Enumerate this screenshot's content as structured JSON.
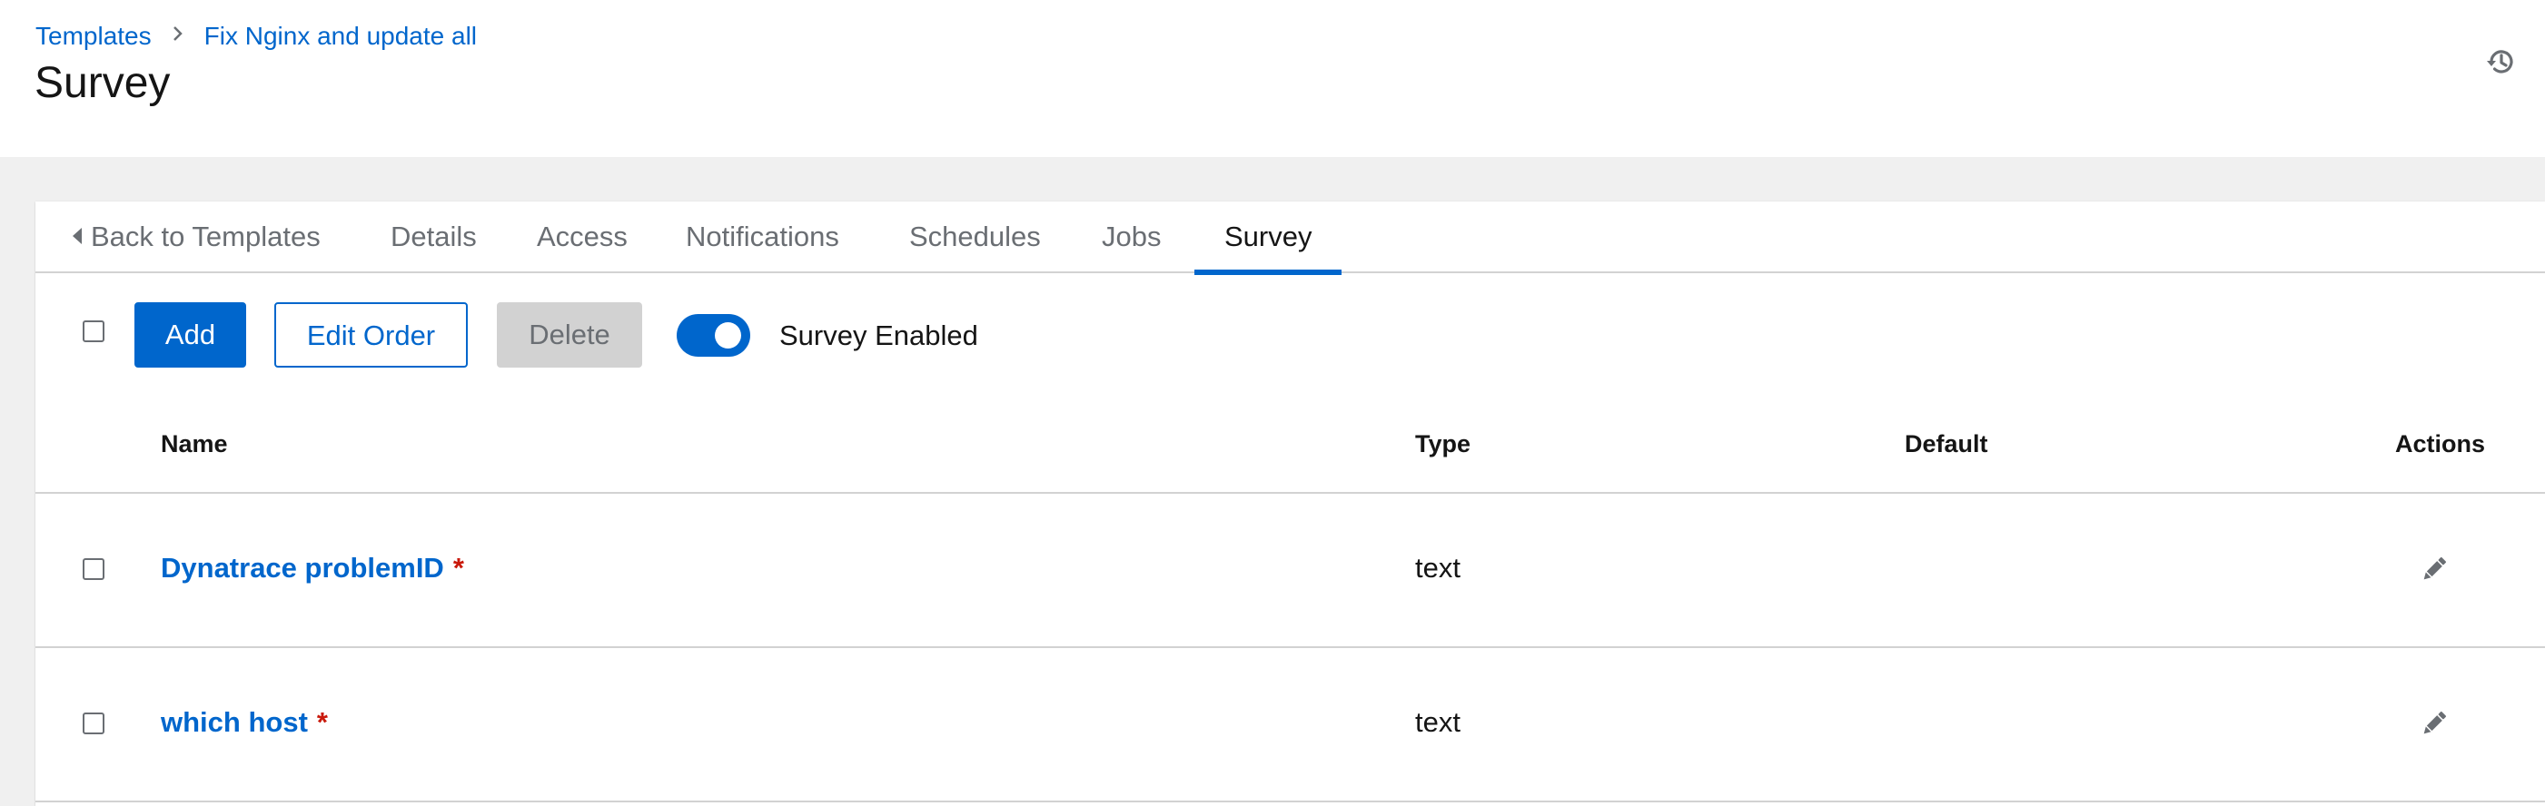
{
  "breadcrumb": {
    "items": [
      "Templates",
      "Fix Nginx and update all"
    ]
  },
  "page": {
    "title": "Survey"
  },
  "tabs": [
    {
      "label": "Back to Templates",
      "icon": "caret-left-icon"
    },
    {
      "label": "Details"
    },
    {
      "label": "Access"
    },
    {
      "label": "Notifications"
    },
    {
      "label": "Schedules"
    },
    {
      "label": "Jobs"
    },
    {
      "label": "Survey",
      "active": true
    }
  ],
  "toolbar": {
    "add_label": "Add",
    "edit_order_label": "Edit Order",
    "delete_label": "Delete",
    "survey_enabled_label": "Survey Enabled",
    "survey_enabled": true
  },
  "table": {
    "columns": [
      "Name",
      "Type",
      "Default",
      "Actions"
    ],
    "rows": [
      {
        "name": "Dynatrace problemID",
        "required_marker": "*",
        "type": "text",
        "default": ""
      },
      {
        "name": "which host",
        "required_marker": "*",
        "type": "text",
        "default": ""
      }
    ]
  },
  "colors": {
    "primary": "#0066cc",
    "required": "#c9190b",
    "disabled_bg": "#d2d2d2",
    "page_bg": "#f0f0f0"
  }
}
